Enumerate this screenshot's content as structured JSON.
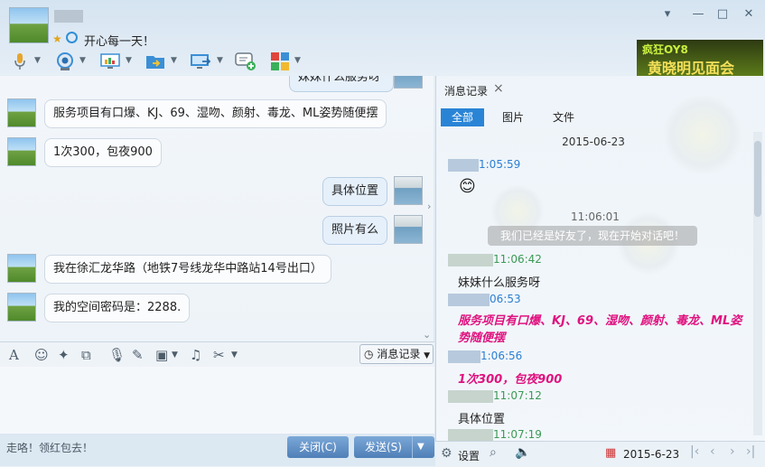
{
  "header": {
    "signature": "开心每一天！",
    "ad_line1": "疯狂OY8",
    "ad_line2": "黄晓明见面会"
  },
  "window_controls": [
    "▾",
    "—",
    "□",
    "✕"
  ],
  "toolbar": {
    "icons": [
      "mic-icon",
      "camera-icon",
      "remote-desktop-icon",
      "file-transfer-icon",
      "screen-share-icon",
      "message-add-icon",
      "apps-icon"
    ]
  },
  "chat": {
    "top_partial": "妹妹什么服务呀",
    "messages": [
      {
        "from": "contact",
        "text": "服务项目有口爆、KJ、69、湿吻、颜射、毒龙、ML姿势随便摆"
      },
      {
        "from": "contact",
        "text": "1次300，包夜900"
      },
      {
        "from": "me",
        "text": "具体位置"
      },
      {
        "from": "me",
        "text": "照片有么"
      },
      {
        "from": "contact",
        "text": "我在徐汇龙华路（地铁7号线龙华中路站14号出口）"
      },
      {
        "from": "contact",
        "text": "我的空间密码是：2288."
      }
    ]
  },
  "input_toolbar": {
    "history_label": "消息记录"
  },
  "status": {
    "text": "走咯！领红包去！"
  },
  "buttons": {
    "close": "关闭(C)",
    "send": "发送(S)"
  },
  "history": {
    "tab_title": "消息记录",
    "tab_close": "×",
    "filters": [
      "全部",
      "图片",
      "文件"
    ],
    "date": "2015-06-23",
    "entries": [
      {
        "time": "1:05:59",
        "color": "blue"
      },
      {
        "time": "11:06:01",
        "color": "gray"
      },
      {
        "system": "我们已经是好友了，现在开始对话吧！"
      },
      {
        "time": "11:06:42",
        "color": "green"
      },
      {
        "text": "妹妹什么服务呀"
      },
      {
        "time": "06:53",
        "color": "blue"
      },
      {
        "text": "服务项目有口爆、KJ、69、湿吻、颜射、毒龙、ML姿势随便摆"
      },
      {
        "time": "1:06:56",
        "color": "blue"
      },
      {
        "text": "1次300，包夜900"
      },
      {
        "time": "11:07:12",
        "color": "green"
      },
      {
        "text": "具体位置"
      },
      {
        "time": "11:07:19",
        "color": "green"
      }
    ],
    "footer_settings": "设置",
    "footer_date": "2015-6-23"
  },
  "colors": {
    "accent": "#2a84d6",
    "pink_text": "#e0127f",
    "time_green": "#3b9a55",
    "time_blue": "#2b7fd2"
  }
}
